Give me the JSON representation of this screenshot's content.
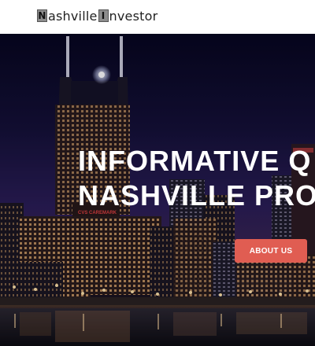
{
  "header": {
    "logo": {
      "box1_letter": "N",
      "word1": "ashville",
      "box2_letter": "I",
      "word2": "nvestor"
    }
  },
  "hero": {
    "title_line1": "INFORMATIVE Q",
    "title_line2": "NASHVILLE PRO",
    "about_button_label": "ABOUT US",
    "background_image": "nashville-night-skyline",
    "building_sign": "CVS CAREMARK"
  },
  "colors": {
    "accent": "#e05d52",
    "header_bg": "#ffffff",
    "hero_text": "#ffffff"
  }
}
